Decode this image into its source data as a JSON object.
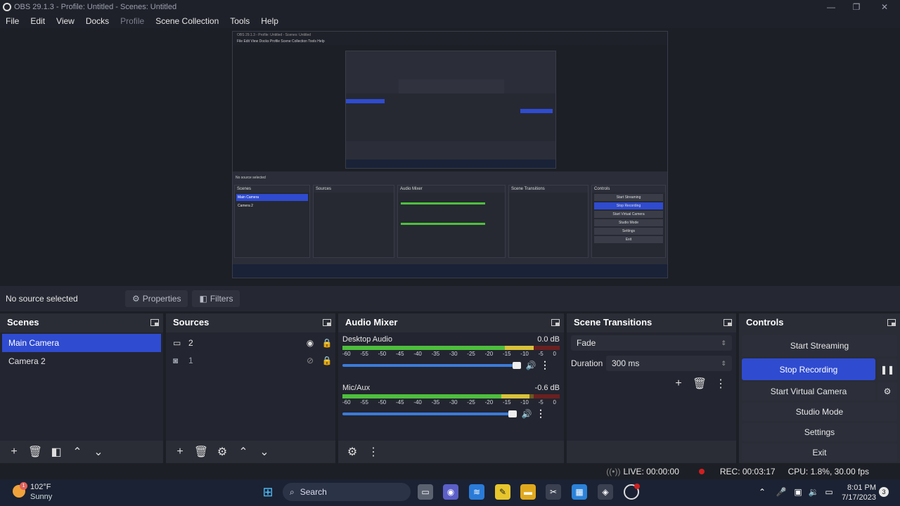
{
  "window": {
    "title": "OBS 29.1.3 - Profile: Untitled - Scenes: Untitled"
  },
  "menu": [
    "File",
    "Edit",
    "View",
    "Docks",
    "Profile",
    "Scene Collection",
    "Tools",
    "Help"
  ],
  "source_bar": {
    "no_source": "No source selected",
    "properties": "Properties",
    "filters": "Filters"
  },
  "scenes": {
    "title": "Scenes",
    "items": [
      "Main Camera",
      "Camera 2"
    ]
  },
  "sources": {
    "title": "Sources",
    "items": [
      "2",
      "1"
    ]
  },
  "audio_mixer": {
    "title": "Audio Mixer",
    "channels": [
      {
        "name": "Desktop Audio",
        "db": "0.0 dB",
        "level": 0.88
      },
      {
        "name": "Mic/Aux",
        "db": "-0.6 dB",
        "level": 0.86
      }
    ],
    "scale": [
      "-60",
      "-55",
      "-50",
      "-45",
      "-40",
      "-35",
      "-30",
      "-25",
      "-20",
      "-15",
      "-10",
      "-5",
      "0"
    ]
  },
  "transitions": {
    "title": "Scene Transitions",
    "type": "Fade",
    "duration_label": "Duration",
    "duration": "300 ms"
  },
  "controls": {
    "title": "Controls",
    "start_streaming": "Start Streaming",
    "stop_recording": "Stop Recording",
    "start_virtual_camera": "Start Virtual Camera",
    "studio_mode": "Studio Mode",
    "settings": "Settings",
    "exit": "Exit"
  },
  "status": {
    "live": "LIVE: 00:00:00",
    "rec": "REC: 00:03:17",
    "cpu": "CPU: 1.8%, 30.00 fps"
  },
  "taskbar": {
    "weather_temp": "102°F",
    "weather_desc": "Sunny",
    "weather_badge": "1",
    "search": "Search",
    "time": "8:01 PM",
    "date": "7/17/2023",
    "notification_count": "3"
  },
  "preview": {
    "title": "OBS 29.1.3 - Profile: Untitled - Scenes: Untitled",
    "menu": "File   Edit   View   Docks   Profile   Scene Collection   Tools   Help",
    "scenes": [
      "Main Camera",
      "Camera 2"
    ],
    "controls": [
      "Start Streaming",
      "Stop Recording",
      "Start Virtual Camera",
      "Studio Mode",
      "Settings",
      "Exit"
    ]
  },
  "colors": {
    "accent": "#2f4bd0",
    "background": "#1d1f26",
    "rec": "#d02020"
  }
}
